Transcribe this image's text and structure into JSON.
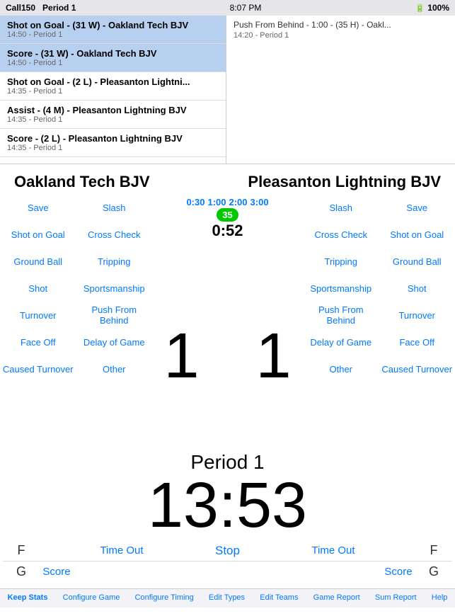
{
  "statusBar": {
    "carrier": "Call150",
    "period": "Period 1",
    "time": "8:07 PM",
    "notification": "Push From Behind - 1:00 - (35 H) - Oakl...",
    "notifSub": "14:20 - Period 1",
    "battery": "100%"
  },
  "feed": [
    {
      "title": "Shot on Goal - (31 W) - Oakland Tech BJV",
      "sub": "14:50 - Period 1",
      "highlighted": true
    },
    {
      "title": "Score - (31 W) - Oakland Tech BJV",
      "sub": "14:50 - Period 1",
      "highlighted": true
    },
    {
      "title": "Shot on Goal - (2 L) - Pleasanton Lightni...",
      "sub": "14:35 - Period 1",
      "highlighted": false
    },
    {
      "title": "Assist - (4 M) - Pleasanton Lightning BJV",
      "sub": "14:35 - Period 1",
      "highlighted": false
    },
    {
      "title": "Score - (2 L) - Pleasanton Lightning BJV",
      "sub": "14:35 - Period 1",
      "highlighted": false
    }
  ],
  "teams": {
    "home": "Oakland Tech BJV",
    "away": "Pleasanton Lightning BJV"
  },
  "homeActions": [
    [
      "Save",
      "Slash"
    ],
    [
      "Shot on Goal",
      "Cross Check"
    ],
    [
      "Ground Ball",
      "Tripping"
    ],
    [
      "Shot",
      "Sportsmanship"
    ],
    [
      "Turnover",
      "Push From Behind"
    ],
    [
      "Face Off",
      "Delay of Game"
    ],
    [
      "Caused Turnover",
      "Other"
    ]
  ],
  "awayActions": [
    [
      "Slash",
      "Save"
    ],
    [
      "Cross Check",
      "Shot on Goal"
    ],
    [
      "Tripping",
      "Ground Ball"
    ],
    [
      "Sportsmanship",
      "Shot"
    ],
    [
      "Push From Behind",
      "Turnover"
    ],
    [
      "Delay of Game",
      "Face Off"
    ],
    [
      "Other",
      "Caused Turnover"
    ]
  ],
  "center": {
    "periods": [
      "0:30",
      "1:00",
      "2:00",
      "3:00"
    ],
    "penalty": "35",
    "penaltyClock": "0:52",
    "homeScore": "1",
    "awayScore": "1"
  },
  "clock": {
    "period": "Period 1",
    "time": "13:53"
  },
  "bottomControls": {
    "row1": {
      "leftLabel": "F",
      "leftBtn": "Time Out",
      "centerBtn": "Stop",
      "rightBtn": "Time Out",
      "rightLabel": "F"
    },
    "row2": {
      "leftLabel": "G",
      "leftBtn": "Score",
      "rightBtn": "Score",
      "rightLabel": "G"
    }
  },
  "tabs": [
    {
      "label": "Keep Stats",
      "active": true
    },
    {
      "label": "Configure Game",
      "active": false
    },
    {
      "label": "Configure Timing",
      "active": false
    },
    {
      "label": "Edit Types",
      "active": false
    },
    {
      "label": "Edit Teams",
      "active": false
    },
    {
      "label": "Game Report",
      "active": false
    },
    {
      "label": "Sum Report",
      "active": false
    },
    {
      "label": "Help",
      "active": false
    }
  ]
}
